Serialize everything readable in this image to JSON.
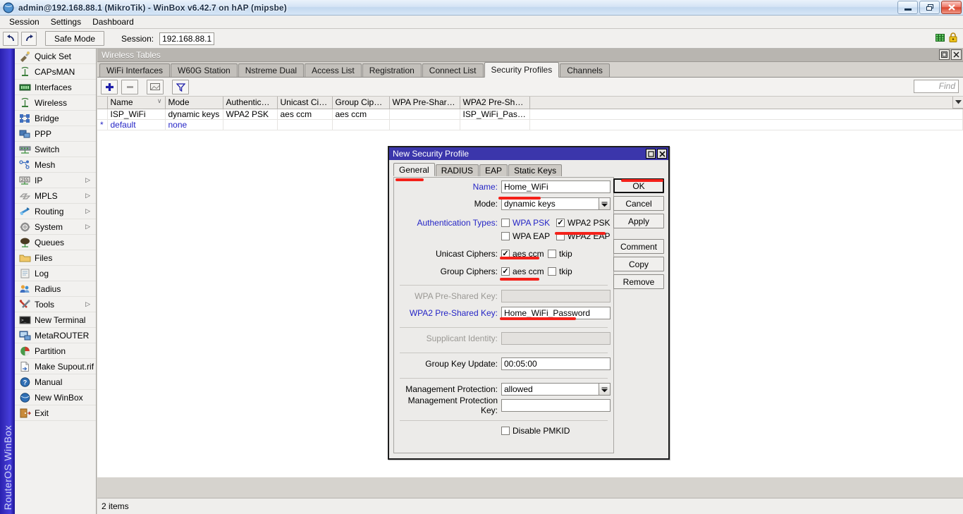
{
  "window": {
    "title": "admin@192.168.88.1 (MikroTik) - WinBox v6.42.7 on hAP (mipsbe)",
    "icon": "winbox-globe-icon",
    "minimize_label": "Minimize",
    "restore_label": "Restore",
    "close_label": "Close"
  },
  "menubar": {
    "items": [
      "Session",
      "Settings",
      "Dashboard"
    ]
  },
  "toolbar": {
    "undo_icon": "undo-arrow-icon",
    "redo_icon": "redo-arrow-icon",
    "safe_mode_label": "Safe Mode",
    "session_label": "Session:",
    "session_value": "192.168.88.1",
    "session_placeholder": "",
    "status_icon_network": "network-activity-icon",
    "status_icon_lock": "lock-icon"
  },
  "sidebar": {
    "brand": "RouterOS WinBox",
    "items": [
      {
        "label": "Quick Set",
        "icon": "quickset-icon",
        "submenu": false
      },
      {
        "label": "CAPsMAN",
        "icon": "capsman-icon",
        "submenu": false
      },
      {
        "label": "Interfaces",
        "icon": "interfaces-icon",
        "submenu": false
      },
      {
        "label": "Wireless",
        "icon": "wireless-icon",
        "submenu": false
      },
      {
        "label": "Bridge",
        "icon": "bridge-icon",
        "submenu": false
      },
      {
        "label": "PPP",
        "icon": "ppp-icon",
        "submenu": false
      },
      {
        "label": "Switch",
        "icon": "switch-icon",
        "submenu": false
      },
      {
        "label": "Mesh",
        "icon": "mesh-icon",
        "submenu": false
      },
      {
        "label": "IP",
        "icon": "ip-icon",
        "submenu": true
      },
      {
        "label": "MPLS",
        "icon": "mpls-icon",
        "submenu": true
      },
      {
        "label": "Routing",
        "icon": "routing-icon",
        "submenu": true
      },
      {
        "label": "System",
        "icon": "system-gear-icon",
        "submenu": true
      },
      {
        "label": "Queues",
        "icon": "queues-icon",
        "submenu": false
      },
      {
        "label": "Files",
        "icon": "folder-icon",
        "submenu": false
      },
      {
        "label": "Log",
        "icon": "log-icon",
        "submenu": false
      },
      {
        "label": "Radius",
        "icon": "radius-icon",
        "submenu": false
      },
      {
        "label": "Tools",
        "icon": "tools-icon",
        "submenu": true
      },
      {
        "label": "New Terminal",
        "icon": "terminal-icon",
        "submenu": false
      },
      {
        "label": "MetaROUTER",
        "icon": "metarouter-icon",
        "submenu": false
      },
      {
        "label": "Partition",
        "icon": "partition-icon",
        "submenu": false
      },
      {
        "label": "Make Supout.rif",
        "icon": "supout-icon",
        "submenu": false
      },
      {
        "label": "Manual",
        "icon": "manual-help-icon",
        "submenu": false
      },
      {
        "label": "New WinBox",
        "icon": "new-winbox-icon",
        "submenu": false
      },
      {
        "label": "Exit",
        "icon": "exit-icon",
        "submenu": false
      }
    ]
  },
  "wireless_window": {
    "title": "Wireless Tables",
    "restore_label": "Restore",
    "close_label": "Close",
    "tabs": [
      {
        "label": "WiFi Interfaces",
        "active": false
      },
      {
        "label": "W60G Station",
        "active": false
      },
      {
        "label": "Nstreme Dual",
        "active": false
      },
      {
        "label": "Access List",
        "active": false
      },
      {
        "label": "Registration",
        "active": false
      },
      {
        "label": "Connect List",
        "active": false
      },
      {
        "label": "Security Profiles",
        "active": true
      },
      {
        "label": "Channels",
        "active": false
      }
    ],
    "table_toolbar": {
      "add_icon": "plus-icon",
      "remove_icon": "minus-icon",
      "comment_icon": "comment-icon",
      "filter_icon": "filter-funnel-icon"
    },
    "find_placeholder": "Find",
    "columns": [
      {
        "label": "Name",
        "sorted": true
      },
      {
        "label": "Mode",
        "sorted": false
      },
      {
        "label": "Authenticatio...",
        "sorted": false
      },
      {
        "label": "Unicast Ciphers",
        "sorted": false
      },
      {
        "label": "Group Ciphers",
        "sorted": false
      },
      {
        "label": "WPA Pre-Shared ...",
        "sorted": false
      },
      {
        "label": "WPA2 Pre-Shared...",
        "sorted": false
      }
    ],
    "rows": [
      {
        "flag": "",
        "name": "ISP_WiFi",
        "mode": "dynamic keys",
        "authentication": "WPA2 PSK",
        "unicast_ciphers": "aes ccm",
        "group_ciphers": "aes ccm",
        "wpa_psk": "",
        "wpa2_psk": "ISP_WiFi_Passw...",
        "is_default": false
      },
      {
        "flag": "*",
        "name": "default",
        "mode": "none",
        "authentication": "",
        "unicast_ciphers": "",
        "group_ciphers": "",
        "wpa_psk": "",
        "wpa2_psk": "",
        "is_default": true
      }
    ],
    "status": "2 items"
  },
  "dialog": {
    "title": "New Security Profile",
    "restore_label": "Restore",
    "close_label": "Close",
    "tabs": [
      {
        "label": "General",
        "active": true
      },
      {
        "label": "RADIUS",
        "active": false
      },
      {
        "label": "EAP",
        "active": false
      },
      {
        "label": "Static Keys",
        "active": false
      }
    ],
    "fields": {
      "name_label": "Name:",
      "name_value": "Home_WiFi",
      "mode_label": "Mode:",
      "mode_value": "dynamic keys",
      "auth_types_label": "Authentication Types:",
      "auth_wpa_psk": {
        "label": "WPA PSK",
        "checked": false,
        "highlight": true
      },
      "auth_wpa2_psk": {
        "label": "WPA2 PSK",
        "checked": true,
        "highlight": false
      },
      "auth_wpa_eap": {
        "label": "WPA EAP",
        "checked": false,
        "highlight": false
      },
      "auth_wpa2_eap": {
        "label": "WPA2 EAP",
        "checked": false,
        "highlight": false
      },
      "unicast_label": "Unicast Ciphers:",
      "unicast_aes": {
        "label": "aes ccm",
        "checked": true
      },
      "unicast_tkip": {
        "label": "tkip",
        "checked": false
      },
      "group_label": "Group Ciphers:",
      "group_aes": {
        "label": "aes ccm",
        "checked": true
      },
      "group_tkip": {
        "label": "tkip",
        "checked": false
      },
      "wpa_psk_label": "WPA Pre-Shared Key:",
      "wpa_psk_value": "",
      "wpa2_psk_label": "WPA2 Pre-Shared Key:",
      "wpa2_psk_value": "Home_WiFi_Password",
      "supplicant_label": "Supplicant Identity:",
      "supplicant_value": "",
      "group_key_update_label": "Group Key Update:",
      "group_key_update_value": "00:05:00",
      "mgmt_protection_label": "Management Protection:",
      "mgmt_protection_value": "allowed",
      "mgmt_protection_key_label": "Management Protection Key:",
      "mgmt_protection_key_value": "",
      "disable_pmkid": {
        "label": "Disable PMKID",
        "checked": false
      }
    },
    "buttons": [
      {
        "label": "OK",
        "primary": true
      },
      {
        "label": "Cancel",
        "primary": false
      },
      {
        "label": "Apply",
        "primary": false
      },
      {
        "label": "Comment",
        "primary": false
      },
      {
        "label": "Copy",
        "primary": false
      },
      {
        "label": "Remove",
        "primary": false
      }
    ]
  },
  "colors": {
    "annotation": "#f4211a",
    "dialog_titlebar": "#3b36ab",
    "sidebar_strip": "#3a31c4",
    "link_blue": "#2525c6"
  }
}
